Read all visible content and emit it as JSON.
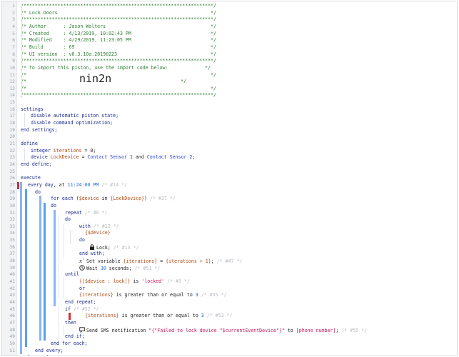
{
  "editor": {
    "line_numbers": [
      "1",
      "2",
      "3",
      "4",
      "5",
      "6",
      "7",
      "8",
      "9",
      "10",
      "11",
      "12",
      "13",
      "14",
      "15",
      "16",
      "17",
      "18",
      "19",
      "20",
      "21",
      "22",
      "23",
      "24",
      "25",
      "26",
      "27",
      "28",
      "29",
      "30",
      "31",
      "32",
      "33",
      "34",
      "35",
      "36",
      "37",
      "38",
      "39",
      "40",
      "41",
      "42",
      "43",
      "44",
      "45",
      "46",
      "47",
      "48",
      "49",
      "50",
      "51"
    ],
    "header": {
      "border": "/*******************************************************************/",
      "l2": "/* Lock Doors                                                      */",
      "l4": "/* Author      : Jason Walters                                     */",
      "l5": "/* Created     : 4/13/2019, 10:02:43 PM                            */",
      "l6": "/* Modified    : 4/29/2019, 11:23:05 PM                            */",
      "l7": "/* Build       : 69                                                */",
      "l8": "/* UI version  : v0.3.10a.20190223                                 */",
      "l10": "/* To import this piston, use the import code below:             */",
      "l11": "/*                                                                 */",
      "l12a": "/*",
      "import_code": "nin2n",
      "l12b": "*/",
      "l13": "/*                                                                 */"
    },
    "settings": {
      "open": "settings",
      "s1": "disable automatic piston state;",
      "s2": "disable command optimization;",
      "close": "end settings;"
    },
    "define": {
      "open": "define",
      "d1_kw": "integer",
      "d1_var": "iterations",
      "d1_rest": " = 0;",
      "d2_kw": "device",
      "d2_var": "LockDevice",
      "d2_eq": " = ",
      "d2_dev1": "Contact Sensor 1",
      "d2_and": " and ",
      "d2_dev2": "Contact Sensor 2",
      "d2_end": ";",
      "close": "end define;"
    },
    "code": {
      "execute": "execute",
      "every_kw": "every day",
      "every_at": ", at ",
      "every_time": "11:24:00 PM",
      "every_id": " /* #14 */",
      "do1": "do",
      "foreach_kw": "for each",
      "foreach_open": " (",
      "foreach_var": "$device",
      "foreach_in": " in ",
      "foreach_list": "{LockDevice}",
      "foreach_close": ")",
      "foreach_id": " /* #37 */",
      "do2": "do",
      "repeat_kw": "repeat",
      "repeat_id": " /* #8 */",
      "do3": "do",
      "with_kw": "with",
      "with_id": " /* #12 */",
      "with_dev": "{$device}",
      "do4": "do",
      "lock_cmd": "Lock;",
      "lock_id": " /* #13 */",
      "endwith": "end with;",
      "setvar_txt": "Set variable ",
      "setvar_v1": "{iterations}",
      "setvar_eq": " = ",
      "setvar_v2": "{iterations + 1}",
      "setvar_end": ";",
      "setvar_id": " /* #47 */",
      "wait_txt": "Wait ",
      "wait_num": "30",
      "wait_rest": " seconds;",
      "wait_id": " /* #51 */",
      "until_kw": "until",
      "cond1_a": "{[$device : lock]}",
      "cond1_b": " is ",
      "cond1_c": "'locked'",
      "cond1_id": " /* #9 */",
      "or_kw": "or",
      "cond2_a": "{iterations}",
      "cond2_b": " is greater than or equal to ",
      "cond2_c": "3",
      "cond2_id": " /* #35 */",
      "endrepeat": "end repeat;",
      "if_kw": "if",
      "if_id": " /* #52 */",
      "cond3_a": "{iterations}",
      "cond3_b": " is greater than or equal to ",
      "cond3_c": "3",
      "cond3_id": " /* #53 */",
      "then_kw": "then",
      "sms_txt": "Send SMS notification ",
      "sms_str": "\"{\"Failed to lock device \"$currentEventDevice\"}\"",
      "sms_to": " to ",
      "sms_phone": "[phone number]",
      "sms_end": ";",
      "sms_id": " /* #55 */",
      "endif": "end if;",
      "endfor": "end for each;",
      "endevery": "end every;",
      "endexec": "end execute;"
    }
  }
}
